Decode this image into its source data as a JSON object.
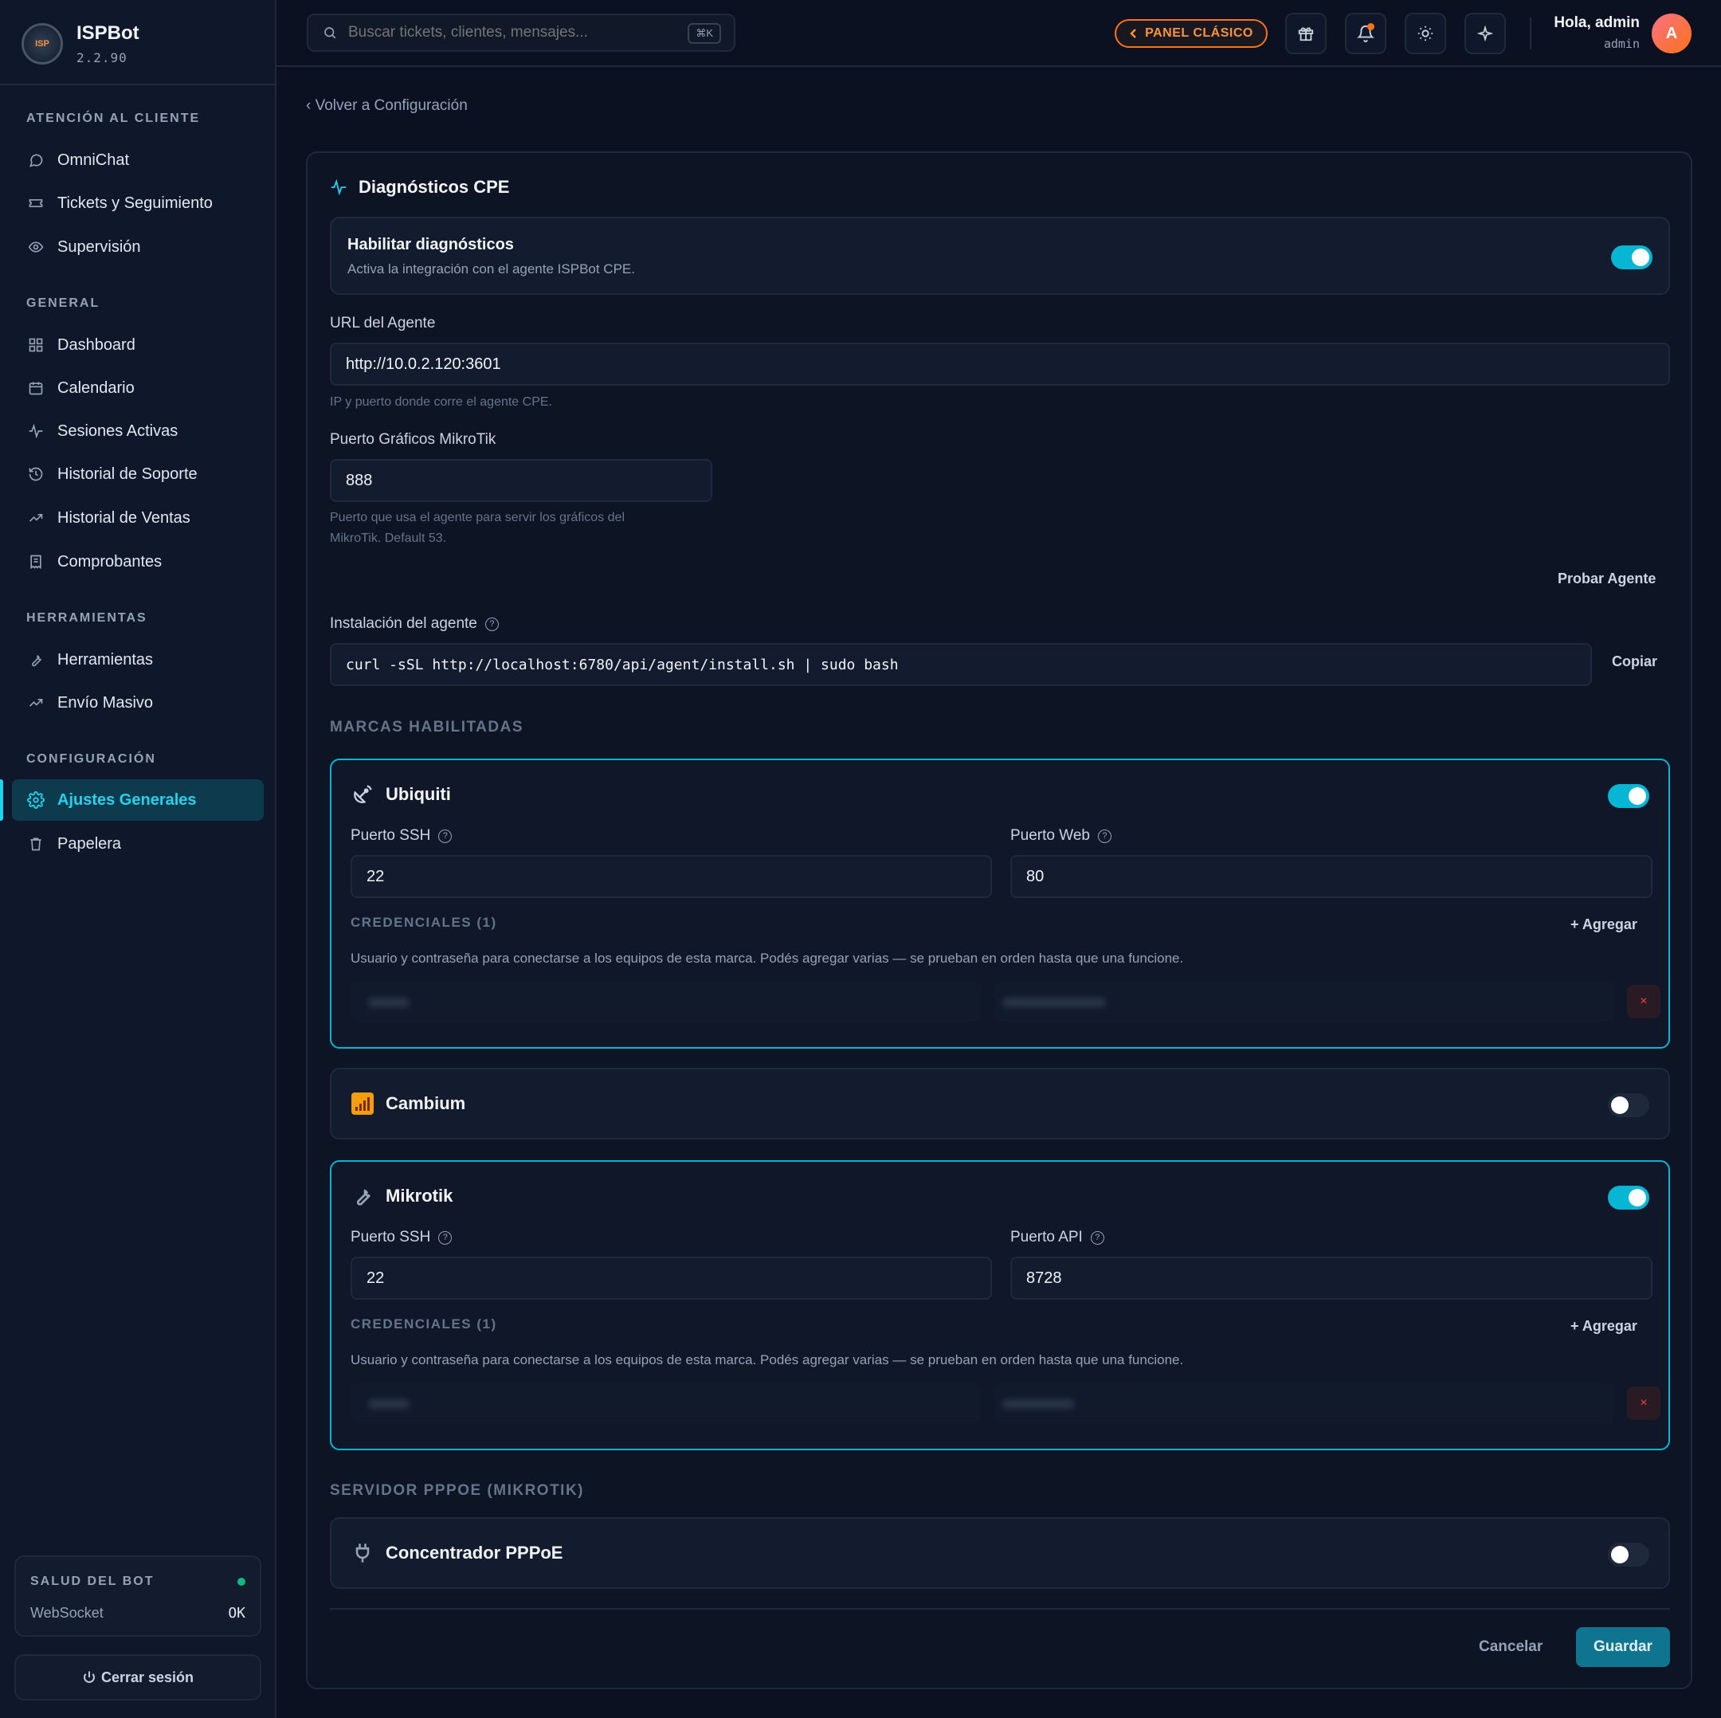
{
  "app": {
    "name": "ISPBot",
    "version": "2.2.90"
  },
  "sidebar": {
    "sections": [
      {
        "title": "ATENCIÓN AL CLIENTE",
        "items": [
          {
            "label": "OmniChat",
            "icon": "chat-icon"
          },
          {
            "label": "Tickets y Seguimiento",
            "icon": "ticket-icon"
          },
          {
            "label": "Supervisión",
            "icon": "eye-icon"
          }
        ]
      },
      {
        "title": "GENERAL",
        "items": [
          {
            "label": "Dashboard",
            "icon": "grid-icon"
          },
          {
            "label": "Calendario",
            "icon": "calendar-icon"
          },
          {
            "label": "Sesiones Activas",
            "icon": "activity-icon"
          },
          {
            "label": "Historial de Soporte",
            "icon": "history-icon"
          },
          {
            "label": "Historial de Ventas",
            "icon": "trending-up-icon"
          },
          {
            "label": "Comprobantes",
            "icon": "receipt-icon"
          }
        ]
      },
      {
        "title": "HERRAMIENTAS",
        "items": [
          {
            "label": "Herramientas",
            "icon": "wrench-icon"
          },
          {
            "label": "Envío Masivo",
            "icon": "trending-up-icon"
          }
        ]
      },
      {
        "title": "CONFIGURACIÓN",
        "items": [
          {
            "label": "Ajustes Generales",
            "icon": "gear-icon",
            "active": true
          },
          {
            "label": "Papelera",
            "icon": "trash-icon"
          }
        ]
      }
    ],
    "health": {
      "title": "SALUD DEL BOT",
      "label": "WebSocket",
      "value": "OK",
      "status_color": "#10b981"
    },
    "logout_label": "Cerrar sesión"
  },
  "topbar": {
    "search_placeholder": "Buscar tickets, clientes, mensajes...",
    "search_shortcut": "⌘K",
    "classic_label": "PANEL CLÁSICO",
    "greeting": "Hola, admin",
    "role": "admin",
    "avatar_initial": "A"
  },
  "main": {
    "back_label": "Volver a Configuración",
    "title": "Diagnósticos CPE",
    "enable": {
      "title": "Habilitar diagnósticos",
      "desc": "Activa la integración con el agente ISPBot CPE.",
      "on": true
    },
    "agent_url": {
      "label": "URL del Agente",
      "value": "http://10.0.2.120:3601",
      "hint": "IP y puerto donde corre el agente CPE."
    },
    "mikrotik_graph_port": {
      "label": "Puerto Gráficos MikroTik",
      "value": "888",
      "hint_line1": "Puerto que usa el agente para servir los gráficos del",
      "hint_line2": "MikroTik. Default 53."
    },
    "test_agent_label": "Probar Agente",
    "install": {
      "label": "Instalación del agente",
      "command": "curl -sSL http://localhost:6780/api/agent/install.sh | sudo bash",
      "copy_label": "Copiar"
    },
    "brands_title": "MARCAS HABILITADAS",
    "ubiquiti": {
      "name": "Ubiquiti",
      "on": true,
      "ssh_label": "Puerto SSH",
      "ssh_value": "22",
      "web_label": "Puerto Web",
      "web_value": "80",
      "cred_title": "CREDENCIALES (1)",
      "add_label": "+ Agregar",
      "cred_desc": "Usuario y contraseña para conectarse a los equipos de esta marca. Podés agregar varias — se prueban en orden hasta que una funcione.",
      "remove_label": "×"
    },
    "cambium": {
      "name": "Cambium",
      "on": false
    },
    "mikrotik": {
      "name": "Mikrotik",
      "on": true,
      "ssh_label": "Puerto SSH",
      "ssh_value": "22",
      "api_label": "Puerto API",
      "api_value": "8728",
      "cred_title": "CREDENCIALES (1)",
      "add_label": "+ Agregar",
      "cred_desc": "Usuario y contraseña para conectarse a los equipos de esta marca. Podés agregar varias — se prueban en orden hasta que una funcione.",
      "remove_label": "×"
    },
    "pppoe_title": "SERVIDOR PPPOE (MIKROTIK)",
    "pppoe": {
      "name": "Concentrador PPPoE",
      "on": false
    },
    "cancel_label": "Cancelar",
    "save_label": "Guardar"
  },
  "colors": {
    "accent": "#06b6d4",
    "classic": "#f97316",
    "background": "#0b1120"
  }
}
